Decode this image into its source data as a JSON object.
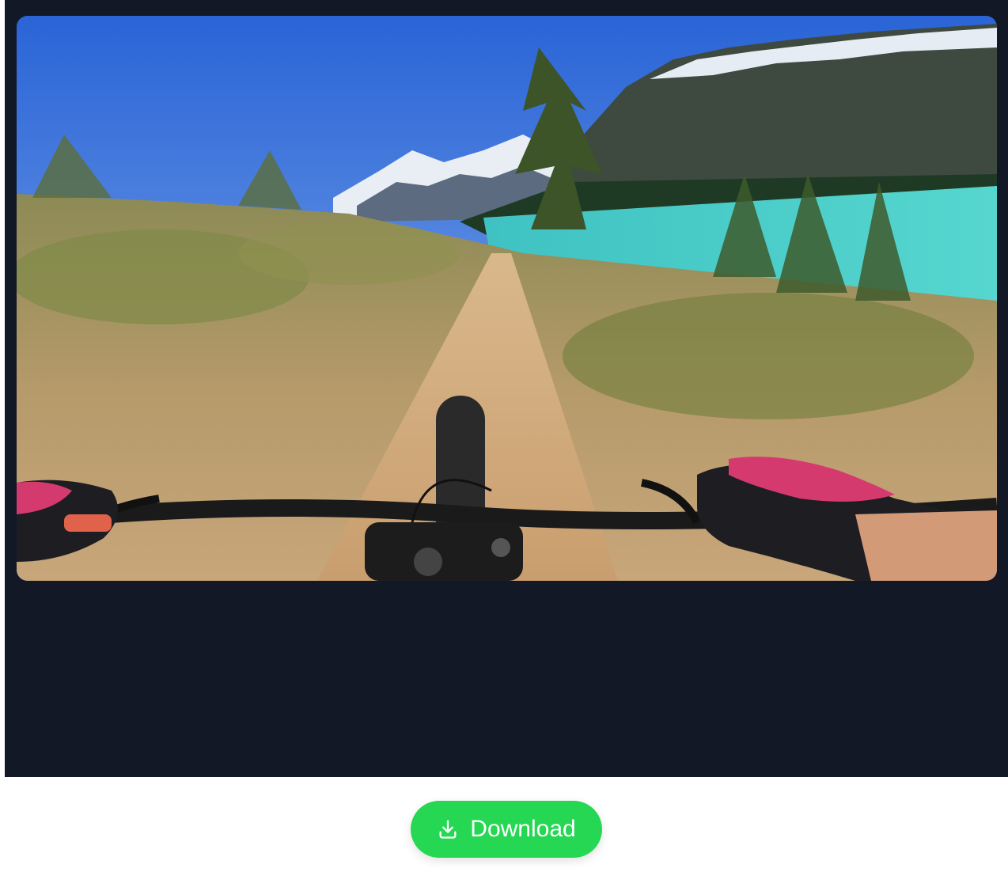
{
  "preview": {
    "image_icon": "first-person-mountain-bike-trail-image"
  },
  "actions": {
    "download_label": "Download",
    "download_icon": "download-icon",
    "download_color": "#25d752"
  },
  "theme": {
    "panel_color": "#121826",
    "footer_color": "#ffffff"
  }
}
